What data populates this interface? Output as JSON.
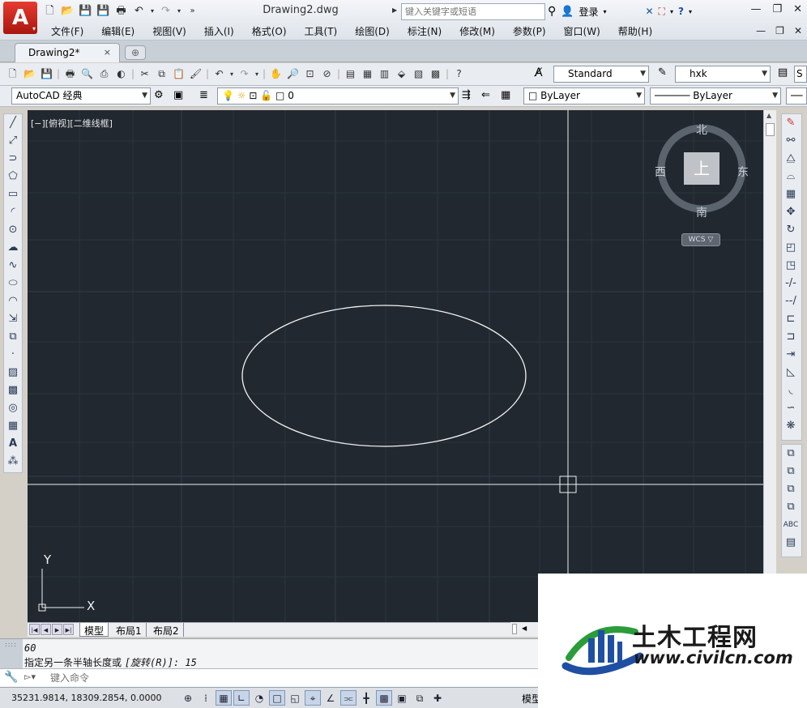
{
  "app": {
    "logo_letter": "A",
    "doc_title": "Drawing2.dwg",
    "search_placeholder": "键入关键字或短语",
    "login": "登录"
  },
  "menu": [
    "文件(F)",
    "编辑(E)",
    "视图(V)",
    "插入(I)",
    "格式(O)",
    "工具(T)",
    "绘图(D)",
    "标注(N)",
    "修改(M)",
    "参数(P)",
    "窗口(W)",
    "帮助(H)"
  ],
  "tabs": {
    "active": "Drawing2*",
    "close": "×"
  },
  "toolbar1": {
    "text_style": "Standard",
    "dim_style": "hxk",
    "table_style_partial": "S"
  },
  "toolbar2": {
    "workspace": "AutoCAD 经典",
    "layer": "0",
    "color": "ByLayer",
    "linetype": "ByLayer"
  },
  "viewport": {
    "label": "[−][俯视][二维线框]",
    "background": "#212830"
  },
  "viewcube": {
    "north": "北",
    "south": "南",
    "east": "东",
    "west": "西",
    "top": "上",
    "wcs": "WCS ▽"
  },
  "ucs": {
    "x": "X",
    "y": "Y"
  },
  "layout_tabs": [
    "模型",
    "布局1",
    "布局2"
  ],
  "command": {
    "history_1": "60",
    "history_2_text": "指定另一条半轴长度或 ",
    "history_2_option": "[旋转(R)]: 15",
    "input_placeholder": "键入命令"
  },
  "status": {
    "coords": "35231.9814, 18309.2854, 0.0000",
    "model_partial": "模型"
  },
  "watermark": {
    "title": "土木工程网",
    "url": "www.civilcn.com"
  }
}
